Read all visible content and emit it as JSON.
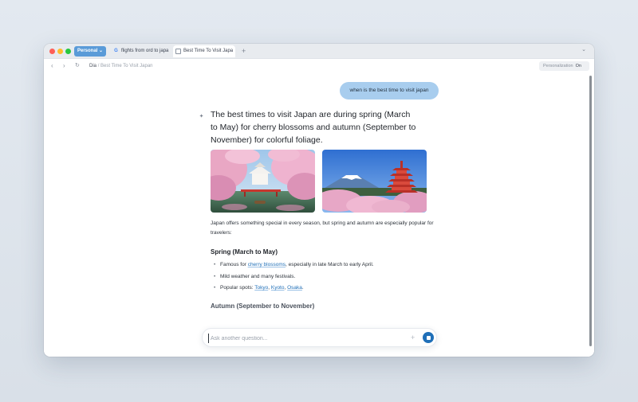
{
  "colors": {
    "accent": "#1f6fb8",
    "user_bubble": "#a8cdee",
    "profile": "#5a9bd8"
  },
  "tabbar": {
    "profile_label": "Personal",
    "tabs": [
      {
        "label": "flights from ord to japa",
        "icon": "google-icon"
      },
      {
        "label": "Best Time To Visit Japa",
        "icon": "document-icon",
        "active": true
      }
    ],
    "new_tab_glyph": "+"
  },
  "toolbar": {
    "breadcrumb_root": "Dia",
    "breadcrumb_sep": "/",
    "breadcrumb_page": "Best Time To Visit Japan",
    "personalization_label": "Personalization",
    "personalization_state": "On"
  },
  "chat": {
    "user_message": "when is the best time to visit japan",
    "headline": "The best times to visit Japan are during spring (March to May) for cherry blossoms and autumn (September to November) for colorful foliage.",
    "intro": "Japan offers something special in every season, but spring and autumn are especially popular for travelers:",
    "spring_title": "Spring (March to May)",
    "spring_bullets": {
      "b1_pre": "Famous for ",
      "b1_link": "cherry blossoms",
      "b1_post": ", especially in late March to early April.",
      "b2": "Mild weather and many festivals.",
      "b3_pre": "Popular spots: ",
      "b3_link1": "Tokyo",
      "b3_sep1": ", ",
      "b3_link2": "Kyoto",
      "b3_sep2": ", ",
      "b3_link3": "Osaka",
      "b3_post": "."
    },
    "autumn_title": "Autumn (September to November)"
  },
  "composer": {
    "placeholder": "Ask another question...",
    "plus_glyph": "+"
  }
}
